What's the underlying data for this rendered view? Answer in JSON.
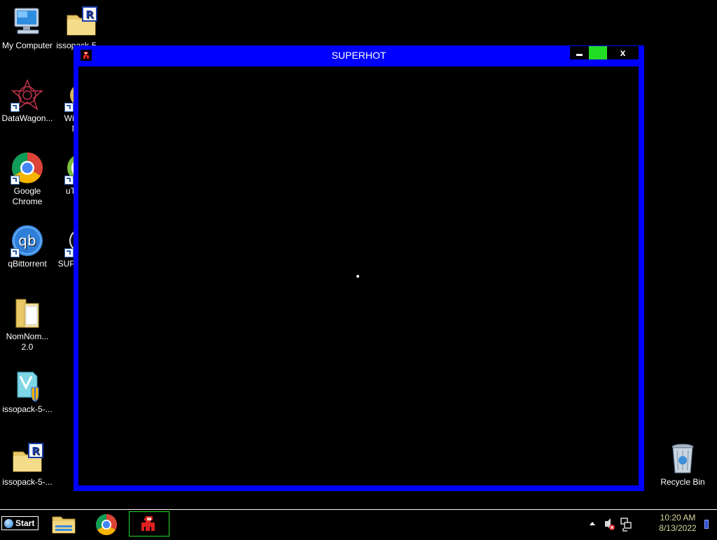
{
  "desktop": {
    "icons": [
      {
        "label": "My Computer",
        "icon": "computer-icon"
      },
      {
        "label": "issopack-5-...",
        "icon": "folder-r-icon"
      },
      {
        "label": "DataWagon...",
        "icon": "datawagon-icon"
      },
      {
        "label": "Windows Me...",
        "icon": "windows-shortcut-icon"
      },
      {
        "label": "Google Chrome",
        "icon": "chrome-icon"
      },
      {
        "label": "uTorrent",
        "icon": "utorrent-icon"
      },
      {
        "label": "qBittorrent",
        "icon": "qbittorrent-icon"
      },
      {
        "label": "SUPERHOT",
        "icon": "superhot-icon"
      },
      {
        "label": "NomNom... 2.0",
        "icon": "folder-icon"
      },
      {
        "label": "issopack-5-...",
        "icon": "installer-icon"
      },
      {
        "label": "issopack-5-...",
        "icon": "folder-r-icon"
      },
      {
        "label": "Recycle Bin",
        "icon": "recycle-bin-icon"
      }
    ]
  },
  "window": {
    "title": "SUPERHOT",
    "close_label": "x"
  },
  "taskbar": {
    "start_label": "Start",
    "clock": {
      "time": "10:20 AM",
      "date": "8/13/2022"
    }
  },
  "colors": {
    "window_frame": "#0000ff",
    "maximize_button": "#22dd22",
    "desktop_background": "#000000",
    "clock_text": "#d8d8a0"
  }
}
